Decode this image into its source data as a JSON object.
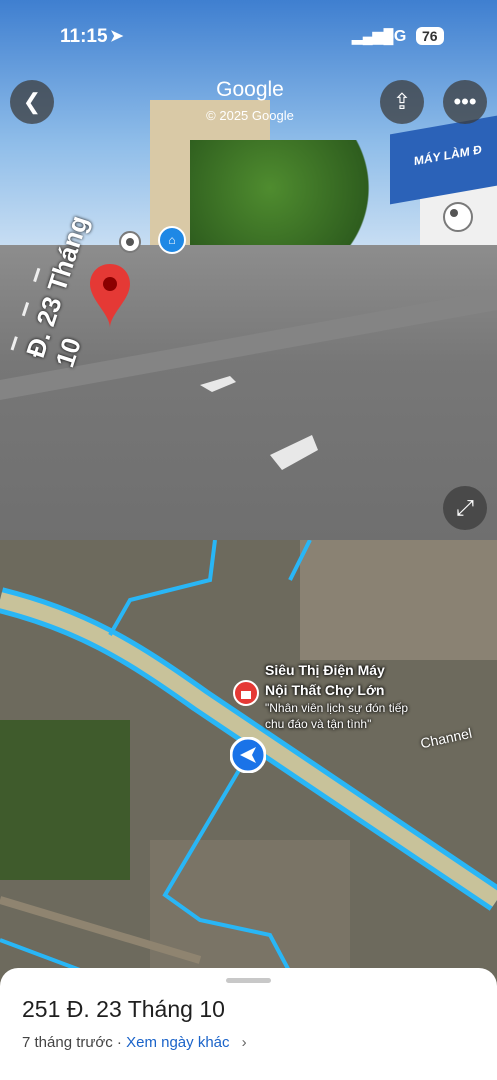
{
  "status_bar": {
    "time": "11:15",
    "network": "5G",
    "battery": "76"
  },
  "street_view": {
    "title": "Google",
    "copyright": "© 2025 Google",
    "store_sign": "MÁY LÀM Đ",
    "street_label": "Đ. 23 Tháng 10"
  },
  "map": {
    "place_name_line1": "Siêu Thị Điện Máy",
    "place_name_line2": "Nội Thất Chợ Lớn",
    "place_quote": "\"Nhân viên lịch sự đón tiếp chu đáo và tận tình\"",
    "water_label": "Channel"
  },
  "sheet": {
    "address": "251 Đ. 23 Tháng 10",
    "age": "7 tháng trước",
    "separator": " · ",
    "other_dates": "Xem ngày khác"
  },
  "colors": {
    "pin": "#e53935",
    "road": "#29b6f6",
    "nav": "#1a73e8",
    "link": "#1a63c9"
  }
}
